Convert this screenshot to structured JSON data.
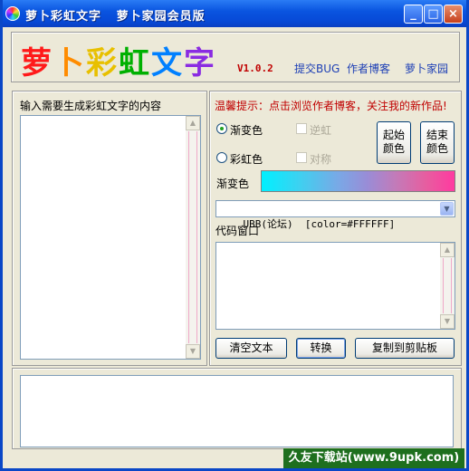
{
  "window": {
    "title": "萝卜彩虹文字   萝卜家园会员版",
    "controls": {
      "minimize": "_",
      "maximize": "□",
      "close": "×"
    }
  },
  "banner": {
    "logo_chars": [
      "萝",
      "卜",
      "彩",
      "虹",
      "文",
      "字"
    ],
    "logo_colors": [
      "#ff1a1a",
      "#ff8c00",
      "#e8e000",
      "#00c000",
      "#0080ff",
      "#8a2be2"
    ],
    "version": "V1.0.2",
    "links": [
      "提交BUG",
      "作者博客",
      "萝卜家园"
    ]
  },
  "left": {
    "label": "输入需要生成彩虹文字的内容",
    "input_value": ""
  },
  "right": {
    "tip": "温馨提示：点击浏览作者博客，关注我的新作品!",
    "radio_gradient": "渐变色",
    "radio_rainbow": "彩虹色",
    "check_reverse": "逆虹",
    "check_symmetric": "对称",
    "start_color_button": "起始\n颜色",
    "end_color_button": "结束\n颜色",
    "gradient_label": "渐变色",
    "format_select": "UBB(论坛)  [color=#FFFFFF]",
    "code_window_label": "代码窗口",
    "code_value": "",
    "clear_button": "清空文本",
    "convert_button": "转换",
    "copy_button": "复制到剪贴板"
  },
  "bottom": {
    "preview_value": ""
  },
  "watermark": "久友下载站(www.9upk.com)",
  "colors": {
    "accent_link": "#1d3fb5",
    "tip": "#c00000",
    "watermark_bg": "#1e6f1e"
  }
}
